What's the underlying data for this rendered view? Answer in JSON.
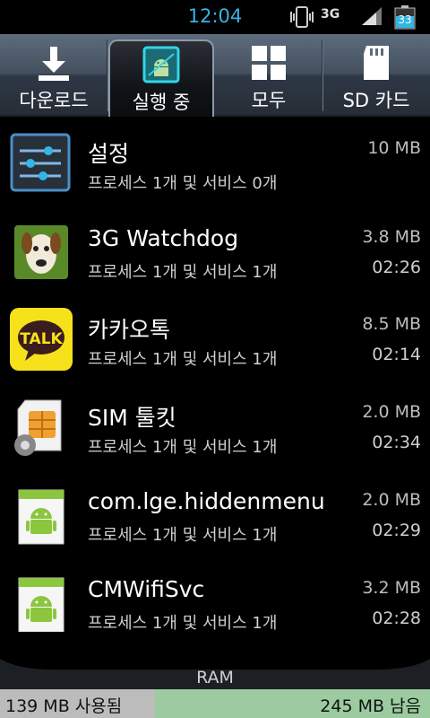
{
  "status_bar": {
    "time": "12:04",
    "network": "3G",
    "battery": "33",
    "icons": [
      "vibrate-icon",
      "signal-icon",
      "battery-icon"
    ]
  },
  "tabs": [
    {
      "label": "다운로드",
      "icon": "download-icon",
      "active": false
    },
    {
      "label": "실행 중",
      "icon": "running-android-icon",
      "active": true
    },
    {
      "label": "모두",
      "icon": "grid-icon",
      "active": false
    },
    {
      "label": "SD 카드",
      "icon": "sd-card-icon",
      "active": false
    }
  ],
  "apps": [
    {
      "name": "설정",
      "sub": "프로세스 1개 및 서비스 0개",
      "size": "10 MB",
      "time": "",
      "icon": "settings-icon"
    },
    {
      "name": "3G Watchdog",
      "sub": "프로세스 1개 및 서비스 1개",
      "size": "3.8 MB",
      "time": "02:26",
      "icon": "watchdog-icon"
    },
    {
      "name": "카카오톡",
      "sub": "프로세스 1개 및 서비스 1개",
      "size": "8.5 MB",
      "time": "02:14",
      "icon": "kakaotalk-icon"
    },
    {
      "name": "SIM 툴킷",
      "sub": "프로세스 1개 및 서비스 1개",
      "size": "2.0 MB",
      "time": "02:34",
      "icon": "sim-toolkit-icon"
    },
    {
      "name": "com.lge.hiddenmenu",
      "sub": "프로세스 1개 및 서비스 1개",
      "size": "2.0 MB",
      "time": "02:29",
      "icon": "android-icon"
    },
    {
      "name": "CMWifiSvc",
      "sub": "프로세스 1개 및 서비스 1개",
      "size": "3.2 MB",
      "time": "02:28",
      "icon": "android-icon"
    }
  ],
  "ram": {
    "label": "RAM",
    "used": "139 MB 사용됨",
    "free": "245 MB 남음",
    "used_fraction": 0.36
  },
  "colors": {
    "accent": "#33b5e5",
    "ram_used": "#bcbcbc",
    "ram_free": "#9ccba0"
  }
}
